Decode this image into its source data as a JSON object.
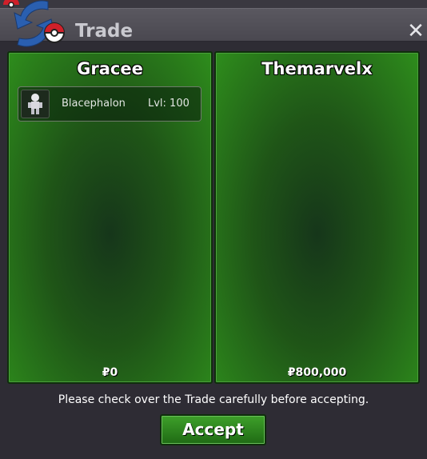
{
  "window": {
    "title": "Trade",
    "close_icon": "close-icon"
  },
  "colors": {
    "panel_green": "#2e8d1c",
    "button_green": "#3ea02a",
    "titlebar": "#4a4850"
  },
  "left_panel": {
    "player": "Gracee",
    "items": [
      {
        "name": "Blacephalon",
        "level": "Lvl: 100"
      }
    ],
    "money": "₽0"
  },
  "right_panel": {
    "player": "Themarvelx",
    "money": "₽800,000"
  },
  "footer": {
    "notice": "Please check over the Trade carefully before accepting.",
    "accept_label": "Accept"
  }
}
